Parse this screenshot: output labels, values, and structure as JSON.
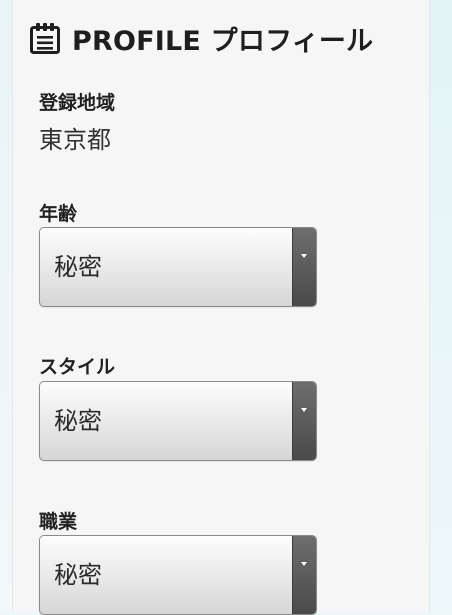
{
  "header": {
    "icon": "clipboard-icon",
    "title": "PROFILE プロフィール"
  },
  "region": {
    "label": "登録地域",
    "value": "東京都"
  },
  "age": {
    "label": "年齢",
    "selected": "秘密"
  },
  "style": {
    "label": "スタイル",
    "selected": "秘密"
  },
  "occupation": {
    "label": "職業",
    "selected": "秘密"
  },
  "colors": {
    "panel": "#f6f6f6",
    "background": "#eef6f7",
    "select_button": "#555555",
    "text": "#222222"
  }
}
